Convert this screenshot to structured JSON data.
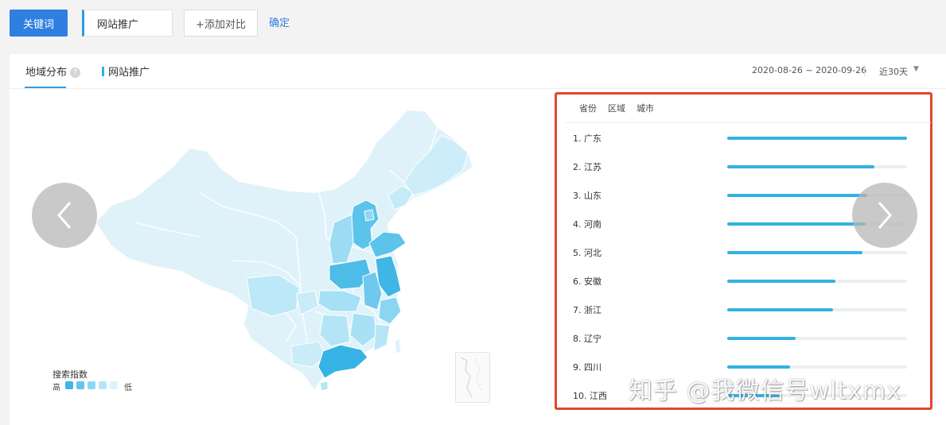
{
  "toolbar": {
    "keyword_button": "关键词",
    "keyword_tag": "网站推广",
    "add_compare": "+添加对比",
    "confirm": "确定"
  },
  "panel": {
    "tab_region": "地域分布",
    "help_symbol": "?",
    "keyword_legend": "网站推广",
    "date_range": "2020-08-26 ~ 2020-09-26",
    "period": "近30天",
    "period_caret": "▼"
  },
  "map": {
    "scale_title": "搜索指数",
    "scale_high": "高",
    "scale_low": "低",
    "scale_colors": [
      "#3bb8e6",
      "#62c7ec",
      "#8dd7f1",
      "#b6e6f6",
      "#dcf3fa"
    ]
  },
  "ranking": {
    "tabs": [
      "省份",
      "区域",
      "城市"
    ],
    "items": [
      {
        "label": "1.  广东",
        "value": 1.0
      },
      {
        "label": "2.  江苏",
        "value": 0.82
      },
      {
        "label": "3.  山东",
        "value": 0.78
      },
      {
        "label": "4.  河南",
        "value": 0.77
      },
      {
        "label": "5.  河北",
        "value": 0.75
      },
      {
        "label": "6.  安徽",
        "value": 0.6
      },
      {
        "label": "7.  浙江",
        "value": 0.59
      },
      {
        "label": "8.  辽宁",
        "value": 0.38
      },
      {
        "label": "9.  四川",
        "value": 0.35
      },
      {
        "label": "10. 江西",
        "value": 0.3
      }
    ]
  },
  "watermark": "知乎 @我微信号wltxmx",
  "colors": {
    "primary": "#2f7fe0",
    "accent": "#2f9be8",
    "bar": "#32b2e2",
    "highlight_border": "#e2462d"
  }
}
